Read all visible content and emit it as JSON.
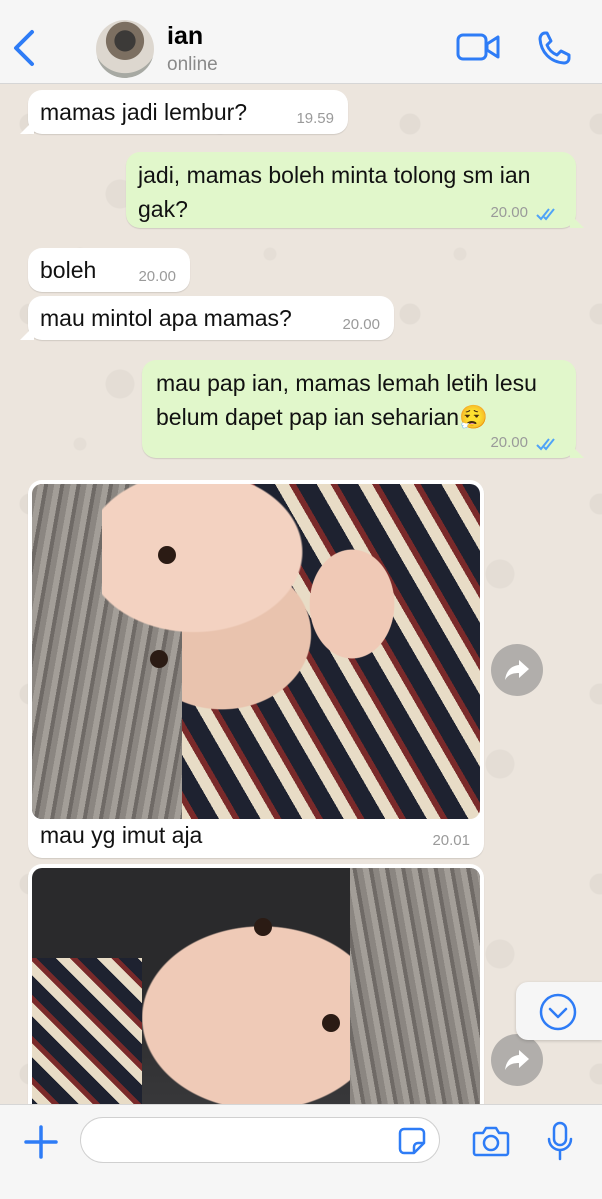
{
  "header": {
    "contact_name": "ian",
    "status": "online",
    "icons": {
      "back": "chevron-left-icon",
      "video": "video-camera-icon",
      "call": "phone-icon"
    },
    "accent_color": "#2e7cf6"
  },
  "messages": [
    {
      "direction": "in",
      "text": "mamas jadi lembur?",
      "time": "19.59"
    },
    {
      "direction": "out",
      "text": "jadi, mamas boleh minta tolong sm ian gak?",
      "time": "20.00",
      "read": true
    },
    {
      "direction": "in",
      "text": "boleh",
      "time": "20.00"
    },
    {
      "direction": "in",
      "text": "mau mintol apa mamas?",
      "time": "20.00"
    },
    {
      "direction": "out",
      "text": "mau pap ian, mamas lemah letih lesu belum dapet pap ian seharian😮‍💨",
      "time": "20.00",
      "read": true
    },
    {
      "direction": "in",
      "type": "photo",
      "caption": "mau yg imut aja",
      "time": "20.01"
    },
    {
      "direction": "in",
      "type": "photo",
      "caption": "",
      "time": ""
    }
  ],
  "input": {
    "placeholder": "",
    "value": ""
  },
  "colors": {
    "incoming_bubble": "#ffffff",
    "outgoing_bubble": "#e1f7cb",
    "read_ticks": "#4fa3f7"
  }
}
